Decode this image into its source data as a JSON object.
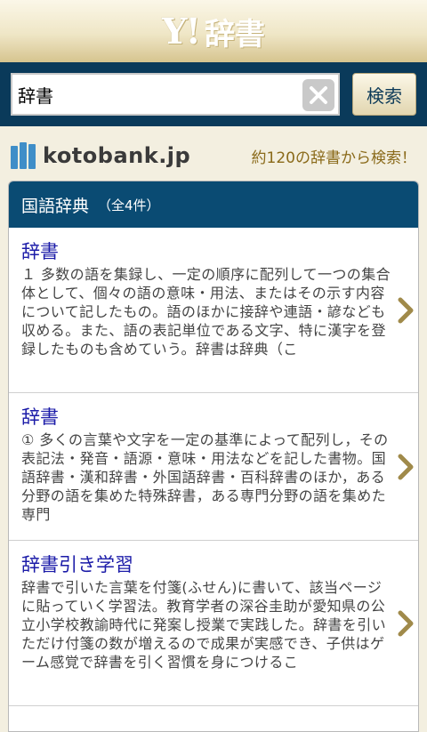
{
  "header": {
    "logo_y": "Y!",
    "logo_jisho": "辞書"
  },
  "search": {
    "value": "辞書",
    "button_label": "検索"
  },
  "brand": {
    "name": "kotobank.jp",
    "tagline": "約120の辞書から検索！"
  },
  "section": {
    "title": "国語辞典",
    "count": "（全4件）"
  },
  "results": [
    {
      "title": "辞書",
      "snippet": "１ 多数の語を集録し、一定の順序に配列して一つの集合体として、個々の語の意味・用法、またはその示す内容について記したもの。語のほかに接辞や連語・諺なども収める。また、語の表記単位である文字、特に漢字を登録したものも含めていう。辞書は辞典（こ"
    },
    {
      "title": "辞書",
      "snippet": "① 多くの言葉や文字を一定の基準によって配列し，その表記法・発音・語源・意味・用法などを記した書物。国語辞書・漢和辞書・外国語辞書・百科辞書のほか，ある分野の語を集めた特殊辞書，ある専門分野の語を集めた専門"
    },
    {
      "title": "辞書引き学習",
      "snippet": "辞書で引いた言葉を付箋(ふせん)に書いて、該当ページに貼っていく学習法。教育学者の深谷圭助が愛知県の公立小学校教諭時代に発案し授業で実践した。辞書を引いただけ付箋の数が増えるので成果が実感でき、子供はゲーム感覚で辞書を引く習慣を身につけるこ"
    }
  ]
}
